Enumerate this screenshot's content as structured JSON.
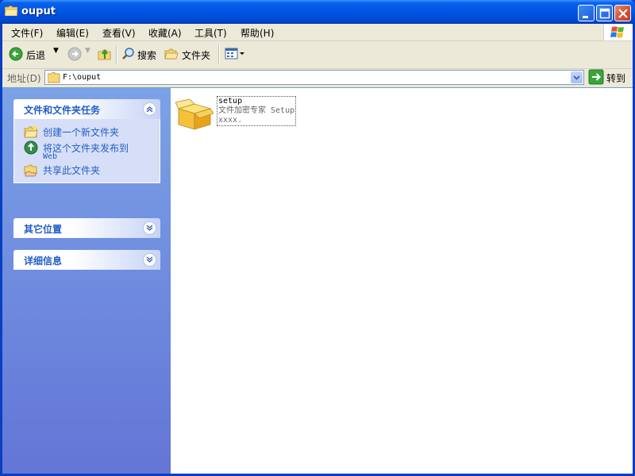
{
  "window": {
    "title": "ouput"
  },
  "menu": {
    "items": [
      "文件(F)",
      "编辑(E)",
      "查看(V)",
      "收藏(A)",
      "工具(T)",
      "帮助(H)"
    ]
  },
  "toolbar": {
    "back_label": "后退",
    "search_label": "搜索",
    "folders_label": "文件夹"
  },
  "address": {
    "label": "地址(D)",
    "value": "F:\\ouput",
    "go_label": "转到"
  },
  "left_pane": {
    "tasks_panel": {
      "title": "文件和文件夹任务",
      "items": [
        {
          "label": "创建一个新文件夹",
          "icon": "new-folder-icon"
        },
        {
          "label": "将这个文件夹发布到",
          "sublabel": "Web",
          "icon": "publish-web-icon"
        },
        {
          "label": "共享此文件夹",
          "icon": "share-folder-icon"
        }
      ]
    },
    "other_places_panel": {
      "title": "其它位置"
    },
    "details_panel": {
      "title": "详细信息"
    }
  },
  "files": [
    {
      "name": "setup",
      "description": "文件加密专家 Setup",
      "version": "xxxx.",
      "icon": "package-box-icon"
    }
  ],
  "colors": {
    "titlebar": "#0054e3",
    "left_pane_top": "#7ba2e7",
    "left_pane_bottom": "#6375d6",
    "task_link": "#215dc6"
  }
}
